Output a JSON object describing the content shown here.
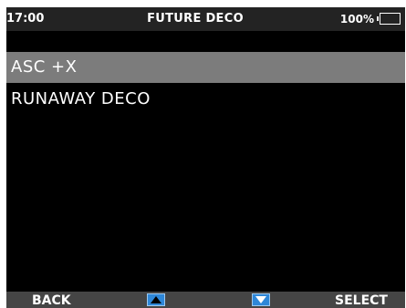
{
  "status_bar": {
    "time": "17:00",
    "title": "FUTURE DECO",
    "battery_percent": "100%",
    "battery_level": 1.0,
    "battery_color": "#4cd42c"
  },
  "menu": {
    "items": [
      {
        "label": "ASC +X",
        "selected": true
      },
      {
        "label": "RUNAWAY DECO",
        "selected": false
      }
    ]
  },
  "softkeys": {
    "back_label": "BACK",
    "up_icon": "arrow-up-icon",
    "down_icon": "arrow-down-icon",
    "select_label": "SELECT",
    "arrow_color": "#2e87d8"
  }
}
